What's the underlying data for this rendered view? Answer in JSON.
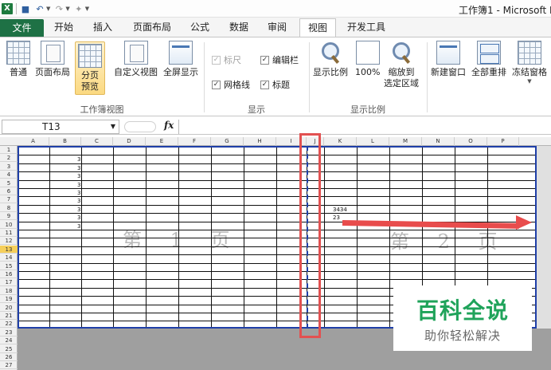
{
  "window": {
    "title": "工作簿1 - Microsoft E"
  },
  "tabs": [
    "文件",
    "开始",
    "插入",
    "页面布局",
    "公式",
    "数据",
    "审阅",
    "视图",
    "开发工具"
  ],
  "active_tab": "视图",
  "ribbon": {
    "workbook_views": {
      "label": "工作簿视图",
      "normal": "普通",
      "page_layout": "页面布局",
      "page_break_preview_l1": "分页",
      "page_break_preview_l2": "预览",
      "custom_views": "自定义视图",
      "full_screen": "全屏显示"
    },
    "show": {
      "label": "显示",
      "ruler": "标尺",
      "formula_bar": "编辑栏",
      "gridlines": "网格线",
      "headings": "标题"
    },
    "zoom": {
      "label": "显示比例",
      "zoom": "显示比例",
      "hundred": "100%",
      "zoom_to_selection_l1": "缩放到",
      "zoom_to_selection_l2": "选定区域"
    },
    "window": {
      "new_window": "新建窗口",
      "arrange_all": "全部重排",
      "freeze_panes": "冻结窗格"
    }
  },
  "formula_bar": {
    "name_box": "T13",
    "fx": "fx",
    "value": ""
  },
  "sheet": {
    "columns": [
      "A",
      "B",
      "C",
      "D",
      "E",
      "F",
      "G",
      "H",
      "I",
      "J",
      "K",
      "L",
      "M",
      "N",
      "O",
      "P"
    ],
    "rows": [
      "1",
      "2",
      "3",
      "4",
      "5",
      "6",
      "7",
      "8",
      "9",
      "10",
      "11",
      "12",
      "13",
      "14",
      "15",
      "16",
      "17",
      "18",
      "19",
      "20",
      "21",
      "22",
      "23",
      "24",
      "25",
      "26",
      "27"
    ],
    "selected_row": "13",
    "column_b_values": [
      "3",
      "3",
      "3",
      "3",
      "3",
      "3",
      "3",
      "3",
      "3"
    ],
    "cell_k7": "3434",
    "cell_j8": "23",
    "page1_label": "第 1 页",
    "page2_label": "第 2 页"
  },
  "watermark": {
    "title": "百科全说",
    "subtitle": "助你轻松解决"
  }
}
